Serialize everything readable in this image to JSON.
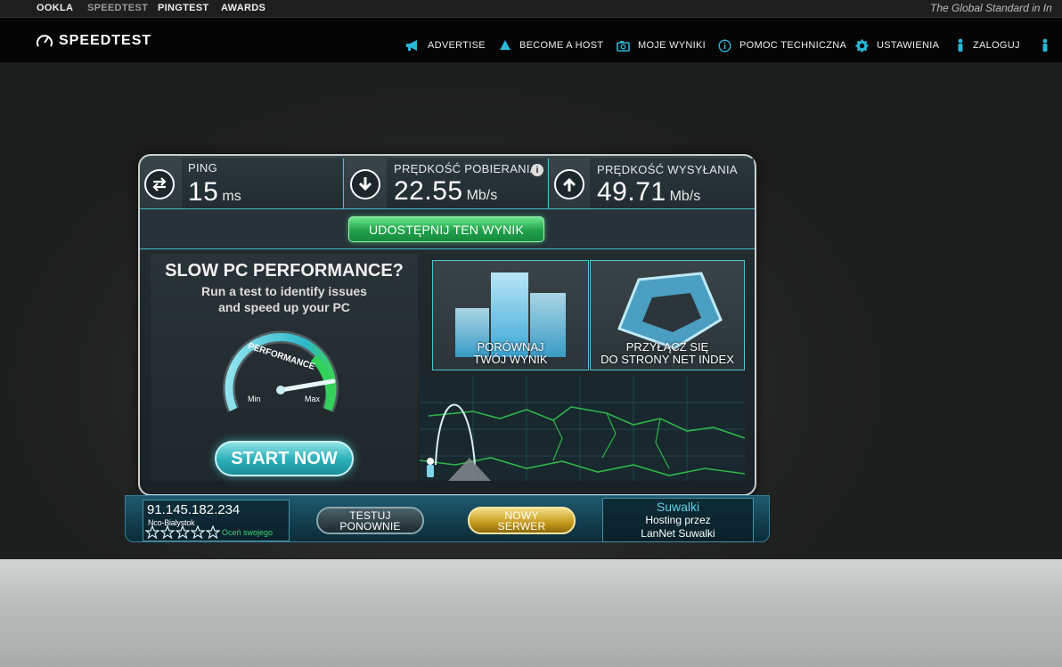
{
  "topbar": {
    "links": [
      "OOKLA",
      "SPEEDTEST",
      "PINGTEST",
      "AWARDS"
    ],
    "tagline": "The Global Standard in In"
  },
  "header": {
    "logo": "SPEEDTEST",
    "nav": [
      {
        "label": "ADVERTISE",
        "icon": "megaphone-icon"
      },
      {
        "label": "BECOME A HOST",
        "icon": "drop-icon"
      },
      {
        "label": "MOJE WYNIKI",
        "icon": "camera-icon"
      },
      {
        "label": "POMOC TECHNICZNA",
        "icon": "info-icon"
      },
      {
        "label": "USTAWIENIA",
        "icon": "gear-icon"
      },
      {
        "label": "ZALOGUJ",
        "icon": "person-icon"
      }
    ]
  },
  "results": {
    "ping": {
      "label": "PING",
      "value": "15",
      "unit": "ms"
    },
    "download": {
      "label": "PRĘDKOŚĆ POBIERANIA",
      "value": "22.55",
      "unit": "Mb/s"
    },
    "upload": {
      "label": "PRĘDKOŚĆ WYSYŁANIA",
      "value": "49.71",
      "unit": "Mb/s"
    }
  },
  "share_button": "UDOSTĘPNIJ TEN WYNIK",
  "ad": {
    "title": "SLOW PC PERFORMANCE?",
    "line1": "Run a test to identify issues",
    "line2": "and speed up your PC",
    "gauge_label": "PERFORMANCE",
    "gauge_min": "Min",
    "gauge_max": "Max",
    "start_button": "START NOW"
  },
  "tiles": {
    "compare_line1": "PORÓWNAJ",
    "compare_line2": "TWÓJ WYNIK",
    "netindex_line1": "PRZYŁĄCZ SIĘ",
    "netindex_line2": "DO STRONY NET INDEX"
  },
  "bottom": {
    "ip": "91.145.182.234",
    "isp": "Nco-Bialystok",
    "rate_text": "Oceń swojego",
    "retest_line1": "TESTUJ",
    "retest_line2": "PONOWNIE",
    "new_line1": "NOWY",
    "new_line2": "SERWER",
    "server_city": "Suwalki",
    "server_line2": "Hosting przez",
    "server_line3": "LanNet Suwalki"
  },
  "colors": {
    "accent": "#3fb8c8",
    "share_green": "#1fa14a",
    "start_cyan": "#2eb2bb",
    "gold": "#c59a1c"
  }
}
